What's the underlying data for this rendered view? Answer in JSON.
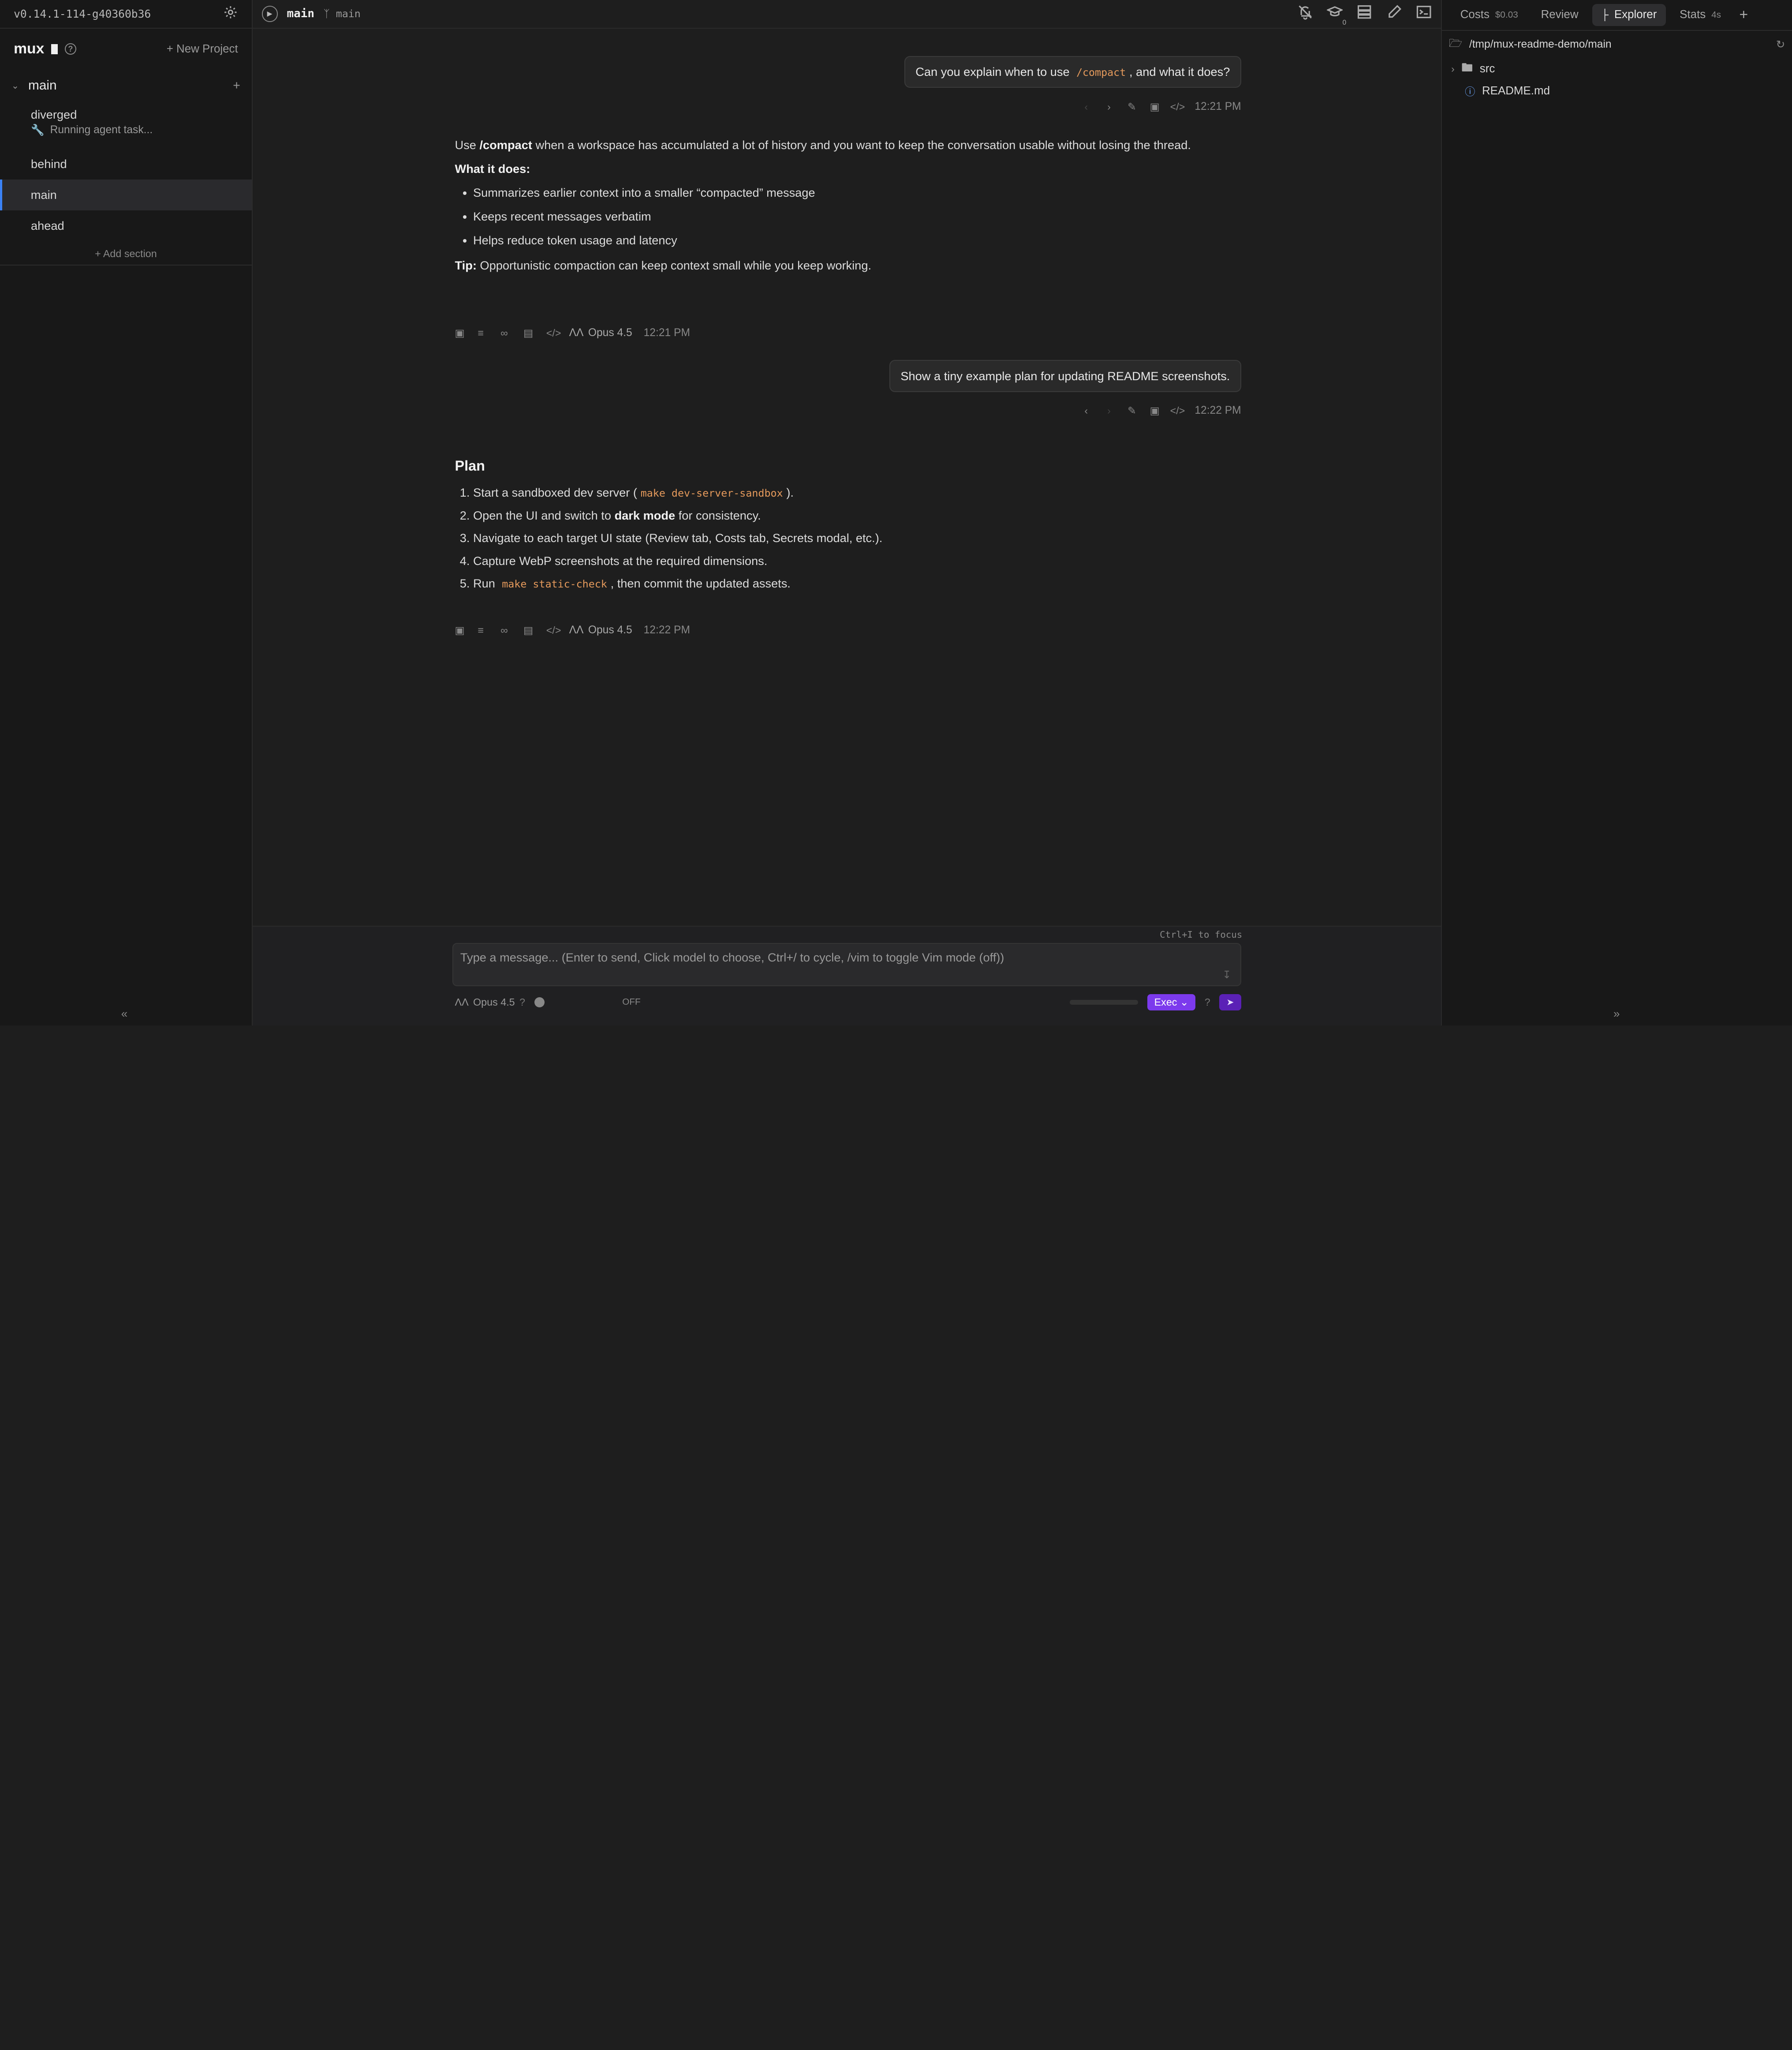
{
  "sidebar": {
    "version": "v0.14.1-114-g40360b36",
    "brand": "mux",
    "new_project": "+ New Project",
    "project": "main",
    "workspaces": [
      {
        "name": "diverged",
        "status": "Running agent task..."
      },
      {
        "name": "behind"
      },
      {
        "name": "main",
        "active": true
      },
      {
        "name": "ahead"
      }
    ],
    "add_section": "+ Add section",
    "collapse": "«"
  },
  "header": {
    "workspace": "main",
    "branch": "main",
    "icons": [
      "bell-off-icon",
      "graduation-cap-icon",
      "layout-icon",
      "pencil-icon",
      "terminal-icon"
    ],
    "notify_count": "0"
  },
  "chat": {
    "msg1": {
      "before": "Can you explain when to use ",
      "code": "/compact",
      "after": ", and what it does?",
      "time": "12:21 PM"
    },
    "resp1": {
      "intro_pre": "Use ",
      "intro_bold": "/compact",
      "intro_post": " when a workspace has accumulated a lot of history and you want to keep the conversation usable without losing the thread.",
      "what_label": "What it does:",
      "bullets": [
        "Summarizes earlier context into a smaller “compacted” message",
        "Keeps recent messages verbatim",
        "Helps reduce token usage and latency"
      ],
      "tip_label": "Tip:",
      "tip_text": " Opportunistic compaction can keep context small while you keep working.",
      "model": "Opus 4.5",
      "time": "12:21 PM"
    },
    "msg2": {
      "text": "Show a tiny example plan for updating README screenshots.",
      "time": "12:22 PM"
    },
    "resp2": {
      "title": "Plan",
      "s1_pre": "Start a sandboxed dev server (",
      "s1_code": "make dev-server-sandbox",
      "s1_post": ").",
      "s2_pre": "Open the UI and switch to ",
      "s2_bold": "dark mode",
      "s2_post": " for consistency.",
      "s3": "Navigate to each target UI state (Review tab, Costs tab, Secrets modal, etc.).",
      "s4": "Capture WebP screenshots at the required dimensions.",
      "s5_pre": "Run ",
      "s5_code": "make static-check",
      "s5_post": ", then commit the updated assets.",
      "model": "Opus 4.5",
      "time": "12:22 PM"
    }
  },
  "input": {
    "focus_hint": "Ctrl+I to focus",
    "placeholder": "Type a message... (Enter to send, Click model to choose, Ctrl+/ to cycle, /vim to toggle Vim mode (off))",
    "model": "Opus 4.5",
    "help": "?",
    "thinking": "OFF",
    "mode": "Exec",
    "mode_help": "?"
  },
  "right_panel": {
    "tabs": [
      {
        "label": "Costs",
        "sub": "$0.03"
      },
      {
        "label": "Review",
        "sub": ""
      },
      {
        "label": "Explorer",
        "sub": ""
      },
      {
        "label": "Stats",
        "sub": "4s"
      }
    ],
    "active_tab": "Explorer",
    "path": "/tmp/mux-readme-demo/main",
    "tree": [
      {
        "name": "src",
        "type": "folder"
      },
      {
        "name": "README.md",
        "type": "file"
      }
    ],
    "collapse": "»"
  }
}
